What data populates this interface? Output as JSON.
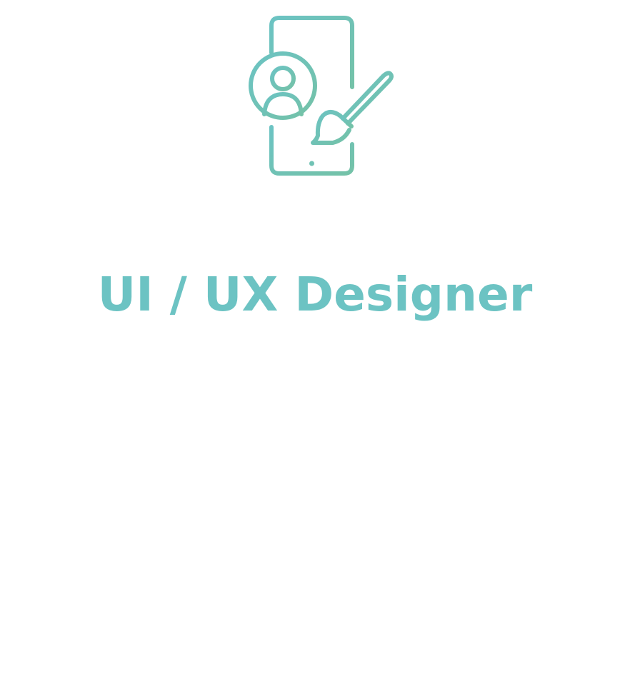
{
  "title": "UI / UX Designer",
  "icon": "phone-target-user-paintbrush-icon",
  "colors": {
    "icon_start": "#6cc3c3",
    "icon_end": "#74c2a8",
    "title": "#6cc3c3",
    "background": "#ffffff"
  }
}
